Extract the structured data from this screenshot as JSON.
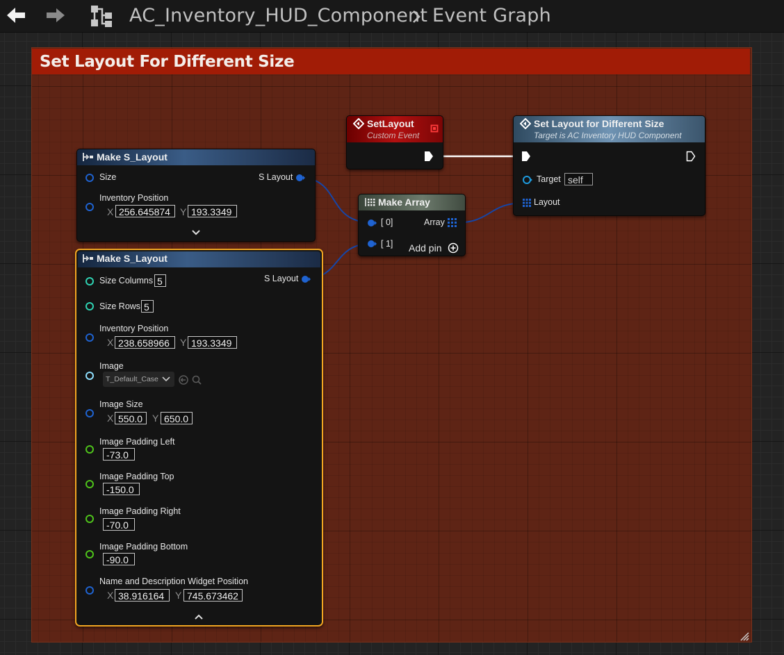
{
  "breadcrumb": {
    "blueprint": "AC_Inventory_HUD_Component",
    "graph": "Event Graph"
  },
  "comment": {
    "title": "Set Layout For Different Size",
    "header_color": "#a11c06",
    "body_color": "#5e2415"
  },
  "make_layout_1": {
    "title": "Make S_Layout",
    "size_label": "Size",
    "output_label": "S Layout",
    "inventory_position_label": "Inventory Position",
    "x_axis": "X",
    "y_axis": "Y",
    "inventory_x": "256.645874",
    "inventory_y": "193.3349",
    "expand_icon": "chevron-down-icon"
  },
  "make_layout_2": {
    "title": "Make S_Layout",
    "output_label": "S Layout",
    "size_columns_label": "Size Columns",
    "size_columns": "5",
    "size_rows_label": "Size Rows",
    "size_rows": "5",
    "inventory_position_label": "Inventory Position",
    "x_axis": "X",
    "y_axis": "Y",
    "inventory_x": "238.658966",
    "inventory_y": "193.3349",
    "image_label": "Image",
    "image_value": "T_Default_Case",
    "image_size_label": "Image Size",
    "image_size_x": "550.0",
    "image_size_y": "650.0",
    "padding_left_label": "Image Padding Left",
    "padding_left": "-73.0",
    "padding_top_label": "Image Padding Top",
    "padding_top": "-150.0",
    "padding_right_label": "Image Padding Right",
    "padding_right": "-70.0",
    "padding_bottom_label": "Image Padding Bottom",
    "padding_bottom": "-90.0",
    "name_desc_label": "Name and Description Widget Position",
    "name_desc_x": "38.916164",
    "name_desc_y": "745.673462",
    "collapse_icon": "chevron-up-icon",
    "selected_color": "#f2a622"
  },
  "set_layout_event": {
    "title": "SetLayout",
    "subtitle": "Custom Event"
  },
  "make_array": {
    "title": "Make Array",
    "pin0": "[ 0]",
    "pin1": "[ 1]",
    "output_label": "Array",
    "add_pin_label": "Add pin"
  },
  "set_layout_func": {
    "title": "Set Layout for Different Size",
    "subtitle": "Target is AC Inventory HUD Component",
    "target_label": "Target",
    "target_value": "self",
    "layout_label": "Layout"
  },
  "colors": {
    "struct_pin": "#1f63d1",
    "int_pin": "#2fd3b3",
    "float_pin": "#4fc41b",
    "object_pin": "#1e9ce0"
  }
}
